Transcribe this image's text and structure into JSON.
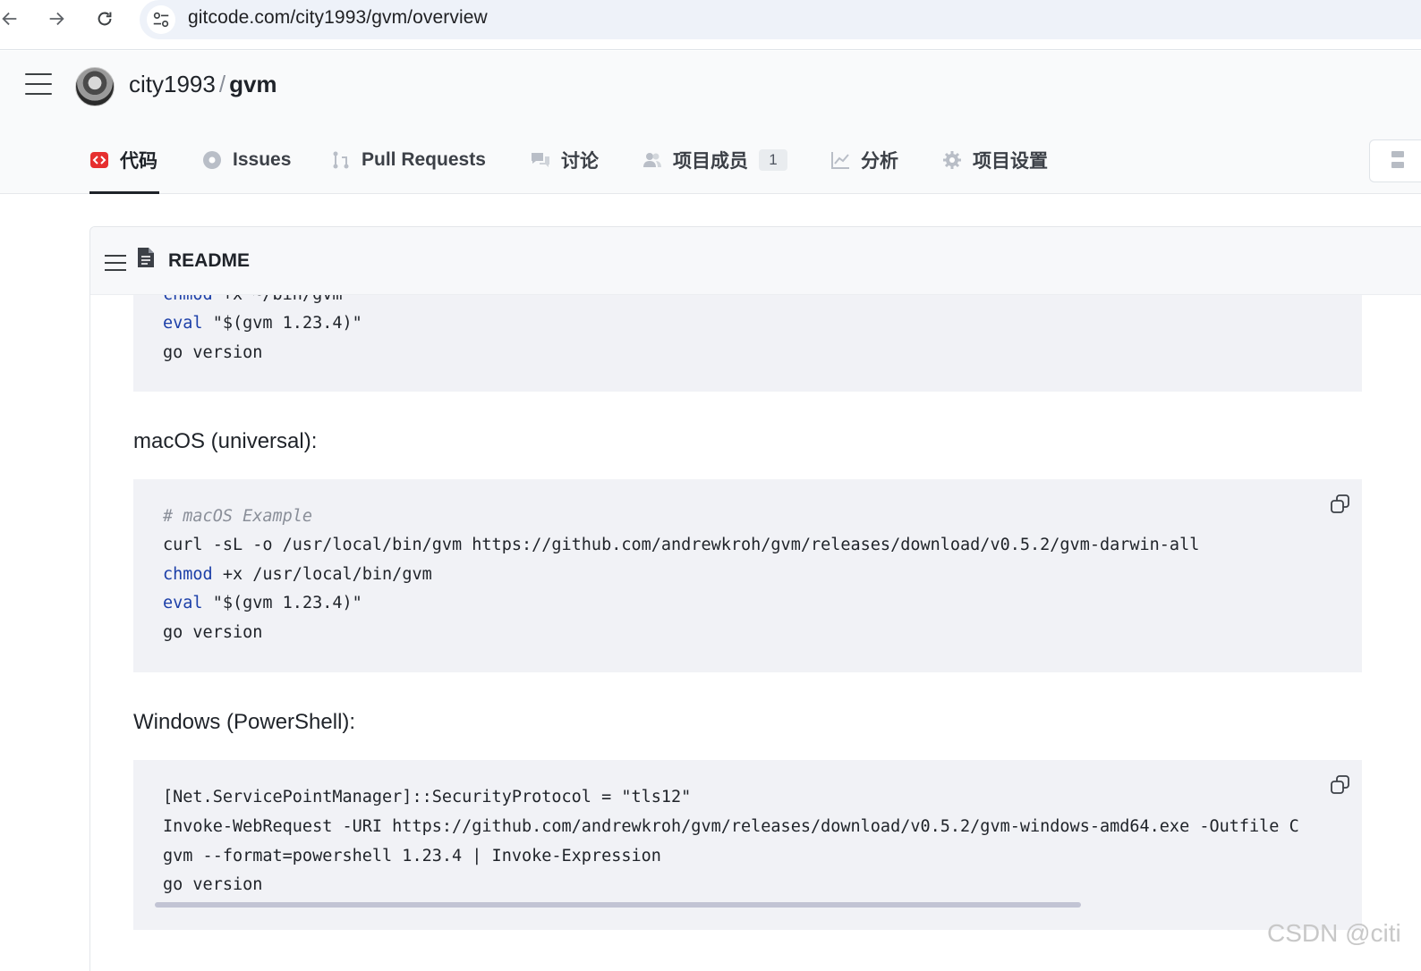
{
  "browser": {
    "url": "gitcode.com/city1993/gvm/overview"
  },
  "repo": {
    "owner": "city1993",
    "separator": "/",
    "name": "gvm"
  },
  "tabs": [
    {
      "label": "代码",
      "icon": "code-icon",
      "active": true
    },
    {
      "label": "Issues",
      "icon": "issues-icon"
    },
    {
      "label": "Pull Requests",
      "icon": "pull-request-icon"
    },
    {
      "label": "讨论",
      "icon": "discussion-icon"
    },
    {
      "label": "项目成员",
      "icon": "members-icon",
      "badge": "1"
    },
    {
      "label": "分析",
      "icon": "analytics-icon"
    },
    {
      "label": "项目设置",
      "icon": "settings-icon"
    }
  ],
  "readme": {
    "title": "README",
    "partial_block": {
      "lines": [
        {
          "kw": "chmod",
          "rest": " +x ~/bin/gvm"
        },
        {
          "kw": "eval",
          "rest": " \"$(gvm 1.23.4)\""
        },
        {
          "kw": "",
          "rest": "go version"
        }
      ]
    },
    "macos": {
      "heading": "macOS (universal):",
      "lines": [
        {
          "comment": "# macOS Example"
        },
        {
          "kw": "",
          "rest": "curl -sL -o /usr/local/bin/gvm https://github.com/andrewkroh/gvm/releases/download/v0.5.2/gvm-darwin-all"
        },
        {
          "kw": "chmod",
          "rest": " +x /usr/local/bin/gvm"
        },
        {
          "kw": "eval",
          "rest": " \"$(gvm 1.23.4)\""
        },
        {
          "kw": "",
          "rest": "go version"
        }
      ]
    },
    "windows": {
      "heading": "Windows (PowerShell):",
      "lines": [
        {
          "kw": "",
          "rest": "[Net.ServicePointManager]::SecurityProtocol = \"tls12\""
        },
        {
          "kw": "",
          "rest": "Invoke-WebRequest -URI https://github.com/andrewkroh/gvm/releases/download/v0.5.2/gvm-windows-amd64.exe -Outfile C"
        },
        {
          "kw": "",
          "rest": "gvm --format=powershell 1.23.4 | Invoke-Expression"
        },
        {
          "kw": "",
          "rest": "go version"
        }
      ]
    }
  },
  "watermark": "CSDN @citi",
  "colors": {
    "accent_red": "#e62f2f",
    "keyword_blue": "#1c3fa8",
    "code_bg": "#f1f2f6"
  }
}
